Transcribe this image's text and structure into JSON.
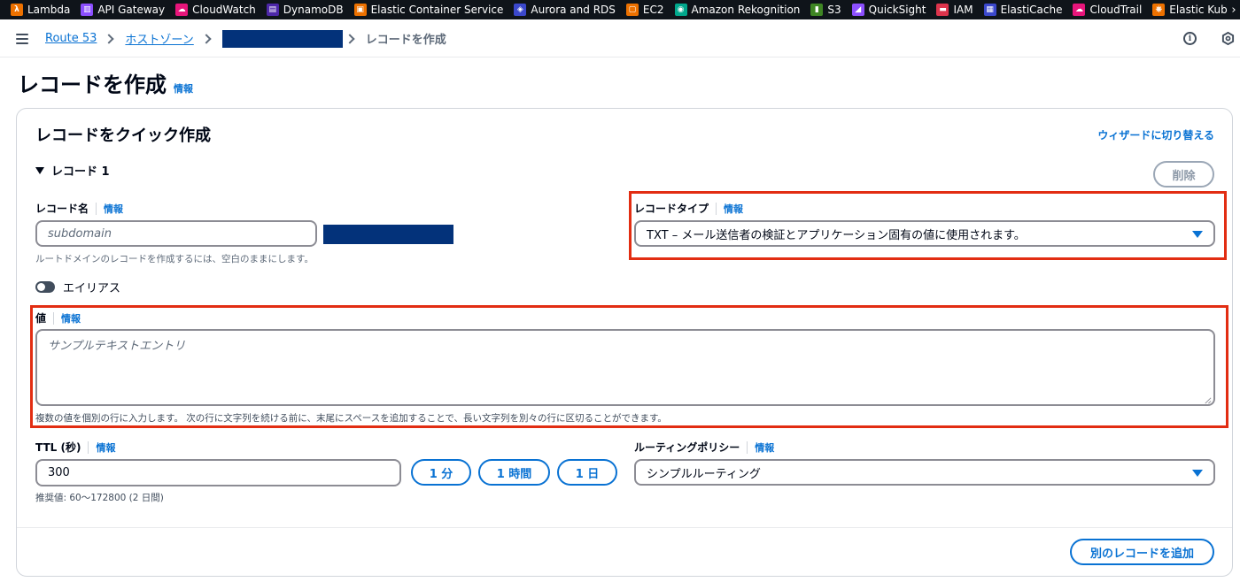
{
  "favorites": [
    {
      "label": "Lambda",
      "icon": "lambda-icon",
      "color": "#ed7100",
      "glyph": "λ"
    },
    {
      "label": "API Gateway",
      "icon": "api-gateway-icon",
      "color": "#8c4fff",
      "glyph": "▥"
    },
    {
      "label": "CloudWatch",
      "icon": "cloudwatch-icon",
      "color": "#e7157b",
      "glyph": "☁"
    },
    {
      "label": "DynamoDB",
      "icon": "dynamodb-icon",
      "color": "#4d27a8",
      "glyph": "▤"
    },
    {
      "label": "Elastic Container Service",
      "icon": "ecs-icon",
      "color": "#ed7100",
      "glyph": "▣"
    },
    {
      "label": "Aurora and RDS",
      "icon": "rds-icon",
      "color": "#3b48cc",
      "glyph": "◈"
    },
    {
      "label": "EC2",
      "icon": "ec2-icon",
      "color": "#ed7100",
      "glyph": "▢"
    },
    {
      "label": "Amazon Rekognition",
      "icon": "rekognition-icon",
      "color": "#01a88d",
      "glyph": "◉"
    },
    {
      "label": "S3",
      "icon": "s3-icon",
      "color": "#3f8624",
      "glyph": "▮"
    },
    {
      "label": "QuickSight",
      "icon": "quicksight-icon",
      "color": "#8c4fff",
      "glyph": "◢"
    },
    {
      "label": "IAM",
      "icon": "iam-icon",
      "color": "#dd344c",
      "glyph": "▬"
    },
    {
      "label": "ElastiCache",
      "icon": "elasticache-icon",
      "color": "#3b48cc",
      "glyph": "▦"
    },
    {
      "label": "CloudTrail",
      "icon": "cloudtrail-icon",
      "color": "#e7157b",
      "glyph": "☁"
    },
    {
      "label": "Elastic Kubernetes Servic",
      "icon": "eks-icon",
      "color": "#ed7100",
      "glyph": "⎈"
    }
  ],
  "breadcrumb": {
    "items": [
      "Route 53",
      "ホストゾーン"
    ],
    "current": "レコードを作成"
  },
  "page": {
    "title": "レコードを作成",
    "info": "情報"
  },
  "form": {
    "title": "レコードをクイック作成",
    "wizard_link": "ウィザードに切り替える",
    "record_header": "レコード 1",
    "delete_label": "削除",
    "record_name": {
      "label": "レコード名",
      "info": "情報",
      "placeholder": "subdomain",
      "hint": "ルートドメインのレコードを作成するには、空白のままにします。"
    },
    "alias_label": "エイリアス",
    "record_type": {
      "label": "レコードタイプ",
      "info": "情報",
      "value": "TXT – メール送信者の検証とアプリケーション固有の値に使用されます。"
    },
    "value_field": {
      "label": "値",
      "info": "情報",
      "placeholder": "サンプルテキストエントリ",
      "hint": "複数の値を個別の行に入力します。 次の行に文字列を続ける前に、末尾にスペースを追加することで、長い文字列を別々の行に区切ることができます。"
    },
    "ttl": {
      "label": "TTL (秒)",
      "info": "情報",
      "value": "300",
      "buttons": [
        "1 分",
        "1 時間",
        "1 日"
      ],
      "hint": "推奨値: 60～172800 (2 日間)"
    },
    "routing": {
      "label": "ルーティングポリシー",
      "info": "情報",
      "value": "シンプルルーティング"
    },
    "add_record_label": "別のレコードを追加"
  },
  "colors": {
    "link": "#0972d3",
    "highlight": "#e22d12",
    "redaction": "#03327a",
    "favbar": "#0f141a"
  }
}
